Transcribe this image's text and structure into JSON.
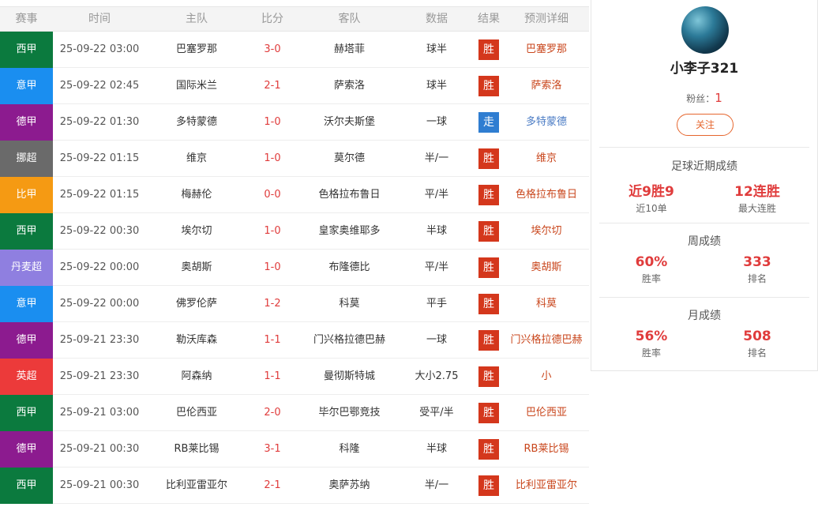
{
  "colors": {
    "win": "#d4371c",
    "draw": "#2f7dd1",
    "pred_win": "#c9461c",
    "pred_draw": "#4a7bc4",
    "league": {
      "西甲": "#0b7a3e",
      "意甲": "#1a8ef0",
      "德甲": "#8c1b8f",
      "挪超": "#6a6a6a",
      "比甲": "#f59a13",
      "丹麦超": "#8f7fe0",
      "英超": "#ec3a3a"
    }
  },
  "header": {
    "league": "赛事",
    "time": "时间",
    "home": "主队",
    "score": "比分",
    "away": "客队",
    "data": "数据",
    "result": "结果",
    "prediction": "预测详细"
  },
  "rows": [
    {
      "league": "西甲",
      "time": "25-09-22 03:00",
      "home": "巴塞罗那",
      "score": "3-0",
      "away": "赫塔菲",
      "data": "球半",
      "result": "胜",
      "prediction": "巴塞罗那"
    },
    {
      "league": "意甲",
      "time": "25-09-22 02:45",
      "home": "国际米兰",
      "score": "2-1",
      "away": "萨索洛",
      "data": "球半",
      "result": "胜",
      "prediction": "萨索洛"
    },
    {
      "league": "德甲",
      "time": "25-09-22 01:30",
      "home": "多特蒙德",
      "score": "1-0",
      "away": "沃尔夫斯堡",
      "data": "一球",
      "result": "走",
      "prediction": "多特蒙德"
    },
    {
      "league": "挪超",
      "time": "25-09-22 01:15",
      "home": "维京",
      "score": "1-0",
      "away": "莫尔德",
      "data": "半/一",
      "result": "胜",
      "prediction": "维京"
    },
    {
      "league": "比甲",
      "time": "25-09-22 01:15",
      "home": "梅赫伦",
      "score": "0-0",
      "away": "色格拉布鲁日",
      "data": "平/半",
      "result": "胜",
      "prediction": "色格拉布鲁日"
    },
    {
      "league": "西甲",
      "time": "25-09-22 00:30",
      "home": "埃尔切",
      "score": "1-0",
      "away": "皇家奥维耶多",
      "data": "半球",
      "result": "胜",
      "prediction": "埃尔切"
    },
    {
      "league": "丹麦超",
      "time": "25-09-22 00:00",
      "home": "奥胡斯",
      "score": "1-0",
      "away": "布隆德比",
      "data": "平/半",
      "result": "胜",
      "prediction": "奥胡斯"
    },
    {
      "league": "意甲",
      "time": "25-09-22 00:00",
      "home": "佛罗伦萨",
      "score": "1-2",
      "away": "科莫",
      "data": "平手",
      "result": "胜",
      "prediction": "科莫"
    },
    {
      "league": "德甲",
      "time": "25-09-21 23:30",
      "home": "勒沃库森",
      "score": "1-1",
      "away": "门兴格拉德巴赫",
      "data": "一球",
      "result": "胜",
      "prediction": "门兴格拉德巴赫"
    },
    {
      "league": "英超",
      "time": "25-09-21 23:30",
      "home": "阿森纳",
      "score": "1-1",
      "away": "曼彻斯特城",
      "data": "大小2.75",
      "result": "胜",
      "prediction": "小"
    },
    {
      "league": "西甲",
      "time": "25-09-21 03:00",
      "home": "巴伦西亚",
      "score": "2-0",
      "away": "毕尔巴鄂竞技",
      "data": "受平/半",
      "result": "胜",
      "prediction": "巴伦西亚"
    },
    {
      "league": "德甲",
      "time": "25-09-21 00:30",
      "home": "RB莱比锡",
      "score": "3-1",
      "away": "科隆",
      "data": "半球",
      "result": "胜",
      "prediction": "RB莱比锡"
    },
    {
      "league": "西甲",
      "time": "25-09-21 00:30",
      "home": "比利亚雷亚尔",
      "score": "2-1",
      "away": "奥萨苏纳",
      "data": "半/一",
      "result": "胜",
      "prediction": "比利亚雷亚尔"
    }
  ],
  "profile": {
    "username": "小李子321",
    "fans_label": "粉丝：",
    "fans_count": "1",
    "follow_label": "关注",
    "recent_title": "足球近期成绩",
    "recent_stat": "近9胜9",
    "recent_stat_label": "近10单",
    "streak_stat": "12连胜",
    "streak_label": "最大连胜",
    "week_title": "周成绩",
    "week_rate": "60%",
    "week_rate_label": "胜率",
    "week_rank": "333",
    "week_rank_label": "排名",
    "month_title": "月成绩",
    "month_rate": "56%",
    "month_rate_label": "胜率",
    "month_rank": "508",
    "month_rank_label": "排名"
  }
}
